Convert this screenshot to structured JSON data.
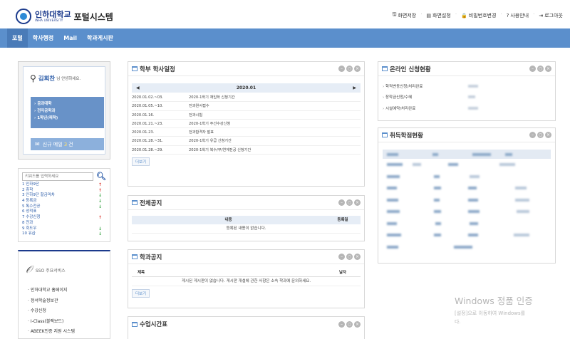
{
  "header": {
    "logo_kor": "인하대학교",
    "logo_eng": "INHA UNIVERSITY",
    "system_title": "포털시스템",
    "util": [
      {
        "icon": "save-icon",
        "glyph": "🖫",
        "label": "화면저장"
      },
      {
        "icon": "layout-icon",
        "glyph": "▤",
        "label": "화면설정"
      },
      {
        "icon": "lock-icon",
        "glyph": "🔒",
        "label": "비밀번호변경"
      },
      {
        "icon": "help-icon",
        "glyph": "?",
        "label": "사용안내"
      },
      {
        "icon": "logout-icon",
        "glyph": "⇥",
        "label": "로그아웃"
      }
    ]
  },
  "nav": {
    "items": [
      "포털",
      "학사행정",
      "Mail",
      "학과게시판"
    ]
  },
  "login": {
    "name": "김희찬",
    "greet": "님 안녕하세요.",
    "info": [
      "공과대학",
      "전자공학과",
      "1학년(재학)"
    ],
    "mail_prefix": "신규 메일",
    "mail_count": "3",
    "mail_suffix": "건"
  },
  "search": {
    "placeholder": "키워드를 입력하세요",
    "keywords": [
      {
        "text": "1 인하9단",
        "trend": "up"
      },
      {
        "text": "2 휴학",
        "trend": "up"
      },
      {
        "text": "3 인하9단 할금마차",
        "trend": "down"
      },
      {
        "text": "4 등록금",
        "trend": "down"
      },
      {
        "text": "5 톡수전공",
        "trend": "down"
      },
      {
        "text": "6 성적표",
        "trend": "none"
      },
      {
        "text": "7 수강신청",
        "trend": "up"
      },
      {
        "text": "8 전과",
        "trend": "none"
      },
      {
        "text": "9 회도우",
        "trend": "down"
      },
      {
        "text": "10 유급",
        "trend": "down"
      }
    ]
  },
  "sso": {
    "title": "SSO 주요서비스",
    "items": [
      "인하대학교 홈페이지",
      "정석학술정보관",
      "수강신청",
      "I-Class(블랙보드)",
      "ABEEK인증 지원 시스템"
    ]
  },
  "schedule": {
    "title": "학부 학사일정",
    "month": "2020.01",
    "rows": [
      {
        "date": "2020.01.02.~03.",
        "event": "2020-1학기 재입학 신청기간"
      },
      {
        "date": "2020.01.05.~10.",
        "event": "전과원서접수"
      },
      {
        "date": "2020.01.16.",
        "event": "전과시험"
      },
      {
        "date": "2020.01.21.~23.",
        "event": "2020-1학기 주선수강신청"
      },
      {
        "date": "2020.01.23.",
        "event": "전과합격자 발표"
      },
      {
        "date": "2020.01.28.~31.",
        "event": "2020-1학기 유급 신청기간"
      },
      {
        "date": "2020.01.28.~29.",
        "event": "2020-1학기 복수/부/연계전공 신청기간"
      }
    ],
    "more": "더보기"
  },
  "notice": {
    "title": "전체공지",
    "col_content": "내용",
    "col_date": "등록일",
    "empty": "등록된 내용이 없습니다."
  },
  "dept": {
    "title": "학과공지",
    "col_title": "제목",
    "col_date": "날자",
    "empty": "게시된 게시판이 없습니다. 게시판 개설에 관한 사항은 소속 학과에 문의하세요.",
    "more": "더보기"
  },
  "classes": {
    "title": "수업시간표"
  },
  "online": {
    "title": "온라인 신청현황",
    "items": [
      "학적변동신청/처리완료",
      "장학금신청/수혜",
      "시설예약/처리완료"
    ]
  },
  "credits": {
    "title": "취득학점현황"
  },
  "watermark": {
    "line1": "Windows 정품 인증",
    "line2": "[설정]으로 이동하여 Windows를",
    "line3": "다."
  },
  "colors": {
    "nav": "#5b8fcc",
    "brand": "#1b3a8c",
    "trend_up": "#d9342b",
    "trend_down": "#2e9e3a"
  }
}
